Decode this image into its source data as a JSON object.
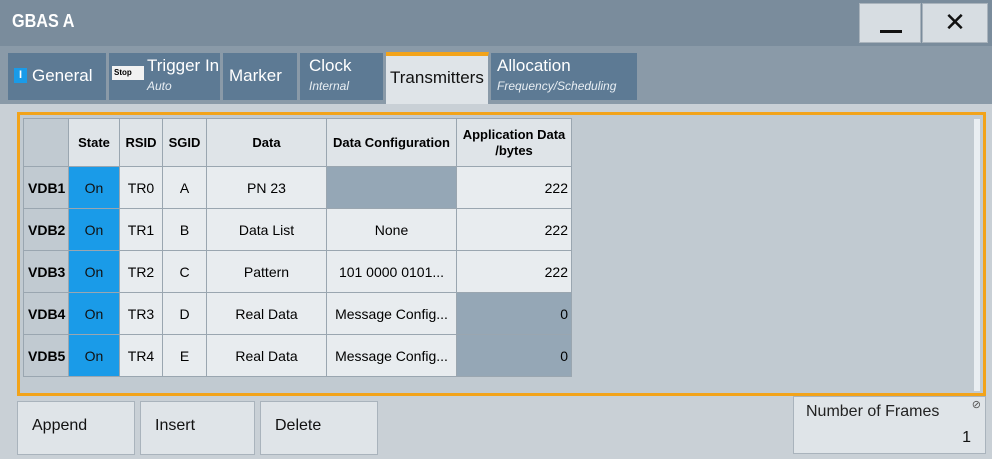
{
  "window": {
    "title": "GBAS A",
    "minimize_glyph": "—",
    "close_glyph": "✕"
  },
  "tabs": [
    {
      "label": "General",
      "badge": "I"
    },
    {
      "label": "Trigger In",
      "sub": "Auto",
      "badge": "Stop"
    },
    {
      "label": "Marker"
    },
    {
      "label": "Clock",
      "sub": "Internal"
    },
    {
      "label": "Transmitters",
      "active": true
    },
    {
      "label": "Allocation",
      "sub": "Frequency/Scheduling"
    }
  ],
  "table": {
    "headers": [
      "",
      "State",
      "RSID",
      "SGID",
      "Data",
      "Data Configuration",
      "Application Data /bytes"
    ],
    "rows": [
      {
        "id": "VDB1",
        "state": "On",
        "rsid": "TR0",
        "sgid": "A",
        "data": "PN 23",
        "config": "",
        "app": "222"
      },
      {
        "id": "VDB2",
        "state": "On",
        "rsid": "TR1",
        "sgid": "B",
        "data": "Data List",
        "config": "None",
        "app": "222"
      },
      {
        "id": "VDB3",
        "state": "On",
        "rsid": "TR2",
        "sgid": "C",
        "data": "Pattern",
        "config": "101 0000 0101...",
        "app": "222"
      },
      {
        "id": "VDB4",
        "state": "On",
        "rsid": "TR3",
        "sgid": "D",
        "data": "Real Data",
        "config": "Message Config...",
        "app": "0"
      },
      {
        "id": "VDB5",
        "state": "On",
        "rsid": "TR4",
        "sgid": "E",
        "data": "Real Data",
        "config": "Message Config...",
        "app": "0"
      }
    ]
  },
  "buttons": {
    "append": "Append",
    "insert": "Insert",
    "delete": "Delete"
  },
  "frames": {
    "label": "Number of Frames",
    "value": "1",
    "mark": "⊘"
  },
  "colors": {
    "accent": "#f2a31a",
    "state_on": "#1a9be8",
    "tab_bg": "#5d7a94",
    "title_bg": "#7a8c9c"
  }
}
